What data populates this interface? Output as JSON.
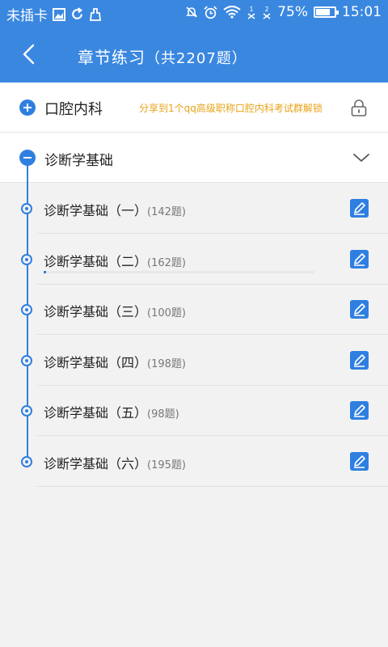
{
  "status_bar": {
    "carrier": "未插卡",
    "battery": "75%",
    "battery_level": 0.75,
    "time": "15:01"
  },
  "app_bar": {
    "title": "章节练习",
    "count": "（共2207题）",
    "back_icon": "chevron-left-icon"
  },
  "subject": {
    "name": "口腔内科",
    "share_text": "分享到1个qq高级职称口腔内科考试群解锁",
    "icon": "plus-circle-icon",
    "lock_icon": "lock-icon"
  },
  "chapter": {
    "name": "诊断学基础",
    "icon": "minus-circle-icon",
    "expand_icon": "chevron-down-icon"
  },
  "items": [
    {
      "title": "诊断学基础（一）",
      "count": "(142题)",
      "progress": null
    },
    {
      "title": "诊断学基础（二）",
      "count": "(162题)",
      "progress": 0.01
    },
    {
      "title": "诊断学基础（三）",
      "count": "(100题)",
      "progress": null
    },
    {
      "title": "诊断学基础（四）",
      "count": "(198题)",
      "progress": null
    },
    {
      "title": "诊断学基础（五）",
      "count": "(98题)",
      "progress": null
    },
    {
      "title": "诊断学基础（六）",
      "count": "(195题)",
      "progress": null
    }
  ],
  "colors": {
    "accent": "#3a87e0",
    "share_text": "#e7a316"
  }
}
